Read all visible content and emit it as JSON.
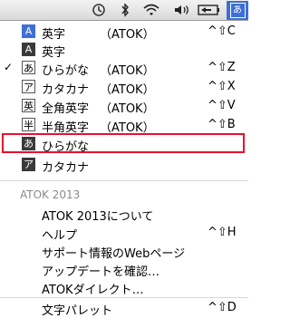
{
  "menubar": {
    "icons": [
      "history-icon",
      "bluetooth-icon",
      "wifi-icon",
      "speaker-icon",
      "battery-icon",
      "input-method-icon"
    ],
    "ime_glyph": "あ"
  },
  "menu": {
    "items": [
      {
        "badge": "A",
        "label": "英字",
        "atok": "（ATOK）",
        "shortcut": "^⇧C",
        "checked": false
      },
      {
        "badge": "A",
        "label": "英字",
        "atok": "",
        "shortcut": "",
        "checked": false
      },
      {
        "badge": "あ",
        "label": "ひらがな",
        "atok": "（ATOK）",
        "shortcut": "^⇧Z",
        "checked": true
      },
      {
        "badge": "ア",
        "label": "カタカナ",
        "atok": "（ATOK）",
        "shortcut": "^⇧X",
        "checked": false
      },
      {
        "badge": "英",
        "label": "全角英字",
        "atok": "（ATOK）",
        "shortcut": "^⇧V",
        "checked": false
      },
      {
        "badge": "半",
        "label": "半角英字",
        "atok": "（ATOK）",
        "shortcut": "^⇧B",
        "checked": false
      },
      {
        "badge": "あ",
        "label": "ひらがな",
        "atok": "",
        "shortcut": "",
        "checked": false
      },
      {
        "badge": "ア",
        "label": "カタカナ",
        "atok": "",
        "shortcut": "",
        "checked": false
      }
    ],
    "check_mark": "✓",
    "section_title": "ATOK 2013",
    "atok_items": [
      {
        "label": "ATOK 2013について",
        "shortcut": ""
      },
      {
        "label": "ヘルプ",
        "shortcut": "^⇧H"
      },
      {
        "label": "サポート情報のWebページ",
        "shortcut": ""
      },
      {
        "label": "アップデートを確認…",
        "shortcut": ""
      },
      {
        "label": "ATOKダイレクト…",
        "shortcut": ""
      }
    ],
    "palette": {
      "label": "文字パレット",
      "shortcut": "^⇧D"
    }
  }
}
